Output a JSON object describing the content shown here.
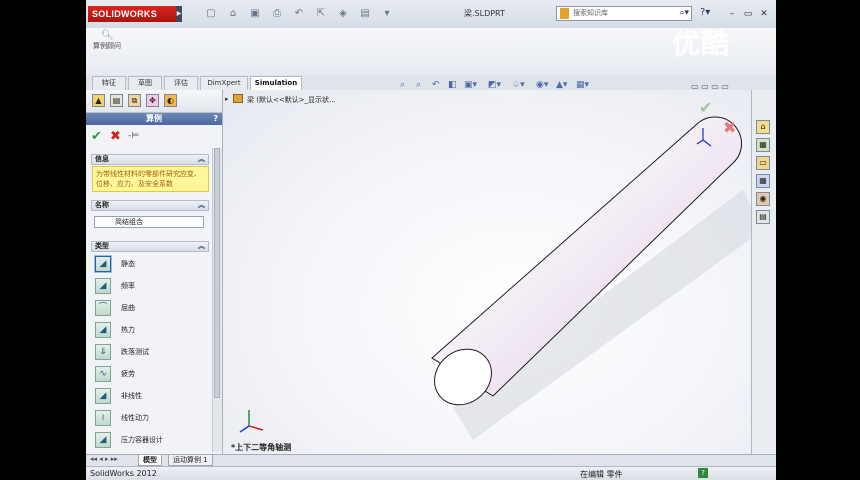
{
  "app": {
    "logo_text": "SOLIDWORKS",
    "document_title": "梁.SLDPRT",
    "search_placeholder": "搜索知识库"
  },
  "ribbon": {
    "calc_label": "算例顾问"
  },
  "tabs": [
    "特征",
    "草图",
    "评估",
    "DimXpert",
    "Simulation"
  ],
  "property_manager": {
    "title": "算例",
    "help": "?",
    "info_header": "信息",
    "info_text": "为带线性材料的零部件研究应变、位移、应力、及安全系数",
    "name_header": "名称",
    "name_value": "简结组合",
    "type_header": "类型",
    "types": [
      {
        "label": "静态",
        "icon": "static-icon"
      },
      {
        "label": "频率",
        "icon": "frequency-icon"
      },
      {
        "label": "屈曲",
        "icon": "buckling-icon"
      },
      {
        "label": "热力",
        "icon": "thermal-icon"
      },
      {
        "label": "跌落测试",
        "icon": "drop-test-icon"
      },
      {
        "label": "疲劳",
        "icon": "fatigue-icon"
      },
      {
        "label": "非线性",
        "icon": "nonlinear-icon"
      },
      {
        "label": "线性动力",
        "icon": "linear-dynamic-icon"
      },
      {
        "label": "压力容器设计",
        "icon": "pressure-vessel-icon"
      }
    ]
  },
  "viewport": {
    "tree_label": "梁 (默认<<默认>_显示状...",
    "view_name": "*上下二等角轴测"
  },
  "bottom_tabs": [
    "模型",
    "运动算例 1"
  ],
  "status": {
    "app_version": "SolidWorks 2012",
    "mode": "在编辑 零件",
    "help": "?"
  },
  "watermark": "优酷",
  "colors": {
    "accent_red": "#c8201a",
    "pm_header_blue": "#4a679e",
    "info_yellow": "#fff79a",
    "ok_green": "#2f9b2f"
  }
}
